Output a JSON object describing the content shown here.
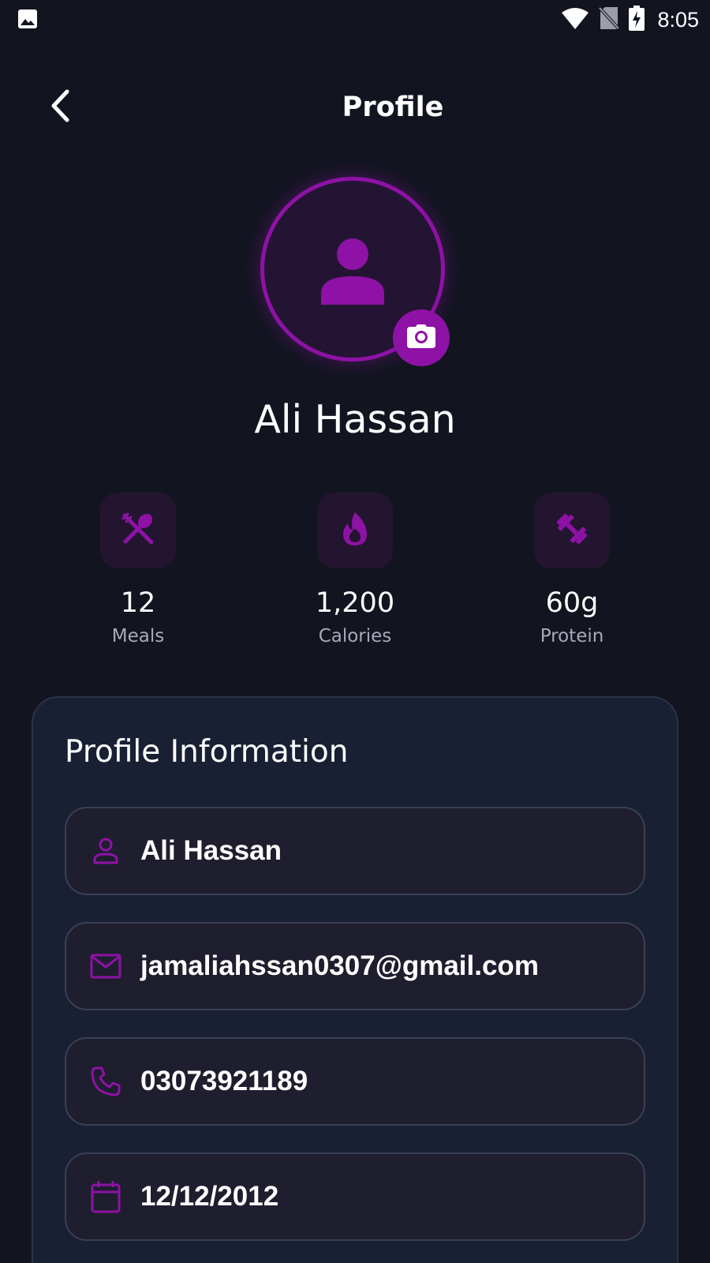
{
  "status_bar": {
    "time": "8:05",
    "icons": [
      "gallery-icon",
      "wifi-icon",
      "no-sim-icon",
      "battery-charging-icon"
    ]
  },
  "header": {
    "title": "Profile",
    "back_icon": "chevron-left-icon"
  },
  "profile": {
    "name": "Ali Hassan",
    "avatar_icon": "person-icon",
    "camera_icon": "camera-icon"
  },
  "stats": [
    {
      "value": "12",
      "label": "Meals",
      "icon": "utensils-icon"
    },
    {
      "value": "1,200",
      "label": "Calories",
      "icon": "flame-icon"
    },
    {
      "value": "60g",
      "label": "Protein",
      "icon": "dumbbell-icon"
    }
  ],
  "profile_info": {
    "title": "Profile Information",
    "fields": [
      {
        "icon": "person-outline-icon",
        "value": "Ali Hassan"
      },
      {
        "icon": "mail-icon",
        "value": "jamaliahssan0307@gmail.com"
      },
      {
        "icon": "phone-icon",
        "value": "03073921189"
      },
      {
        "icon": "calendar-icon",
        "value": "12/12/2012"
      }
    ]
  },
  "colors": {
    "background": "#121520",
    "accent": "#8e12a5",
    "card": "#1a2033",
    "field": "#1e1e2f",
    "muted_text": "#a7abb8"
  }
}
